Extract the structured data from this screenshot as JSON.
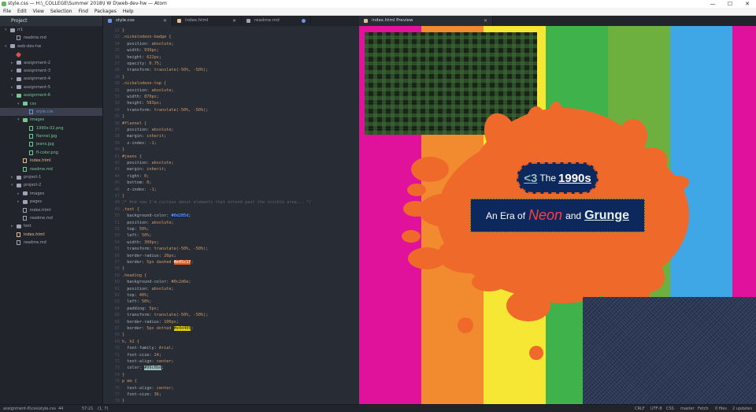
{
  "window": {
    "title": "style.css — H:\\_COLLEGE\\Summer 2018\\I W D\\web-dev-hw — Atom",
    "min": "—",
    "max": "☐",
    "close": "✕"
  },
  "menu": [
    "File",
    "Edit",
    "View",
    "Selection",
    "Find",
    "Packages",
    "Help"
  ],
  "tree": {
    "header": "Project",
    "rows": [
      {
        "label": "rr1",
        "depth": 0,
        "kind": "folder",
        "open": true
      },
      {
        "label": "readme.md",
        "depth": 1,
        "kind": "file"
      },
      {
        "label": "web-dev-hw",
        "depth": 0,
        "kind": "folder",
        "open": true
      },
      {
        "label": "",
        "depth": 1,
        "kind": "git",
        "color": "red"
      },
      {
        "label": "assignment-2",
        "depth": 1,
        "kind": "folder"
      },
      {
        "label": "assignment-3",
        "depth": 1,
        "kind": "folder"
      },
      {
        "label": "assignment-4",
        "depth": 1,
        "kind": "folder"
      },
      {
        "label": "assignment-5",
        "depth": 1,
        "kind": "folder"
      },
      {
        "label": "assignment-6",
        "depth": 1,
        "kind": "folder",
        "open": true,
        "color": "green"
      },
      {
        "label": "css",
        "depth": 2,
        "kind": "folder",
        "open": true,
        "color": "green"
      },
      {
        "label": "style.css",
        "depth": 3,
        "kind": "file",
        "color": "blue",
        "selected": true
      },
      {
        "label": "images",
        "depth": 2,
        "kind": "folder",
        "open": true,
        "color": "green"
      },
      {
        "label": "1990s-02.png",
        "depth": 3,
        "kind": "file",
        "color": "green"
      },
      {
        "label": "flannel.jpg",
        "depth": 3,
        "kind": "file",
        "color": "green"
      },
      {
        "label": "jeans.jpg",
        "depth": 3,
        "kind": "file",
        "color": "green"
      },
      {
        "label": "fl-color.png",
        "depth": 3,
        "kind": "file",
        "color": "green"
      },
      {
        "label": "index.html",
        "depth": 2,
        "kind": "file",
        "color": "orange"
      },
      {
        "label": "readme.md",
        "depth": 2,
        "kind": "file",
        "color": "green"
      },
      {
        "label": "project-1",
        "depth": 1,
        "kind": "folder"
      },
      {
        "label": "project-2",
        "depth": 1,
        "kind": "folder",
        "open": true
      },
      {
        "label": "images",
        "depth": 2,
        "kind": "folder"
      },
      {
        "label": "pages",
        "depth": 2,
        "kind": "folder"
      },
      {
        "label": "index.html",
        "depth": 2,
        "kind": "file"
      },
      {
        "label": "readme.md",
        "depth": 2,
        "kind": "file"
      },
      {
        "label": "test",
        "depth": 1,
        "kind": "folder"
      },
      {
        "label": "index.html",
        "depth": 1,
        "kind": "file",
        "color": "orange"
      },
      {
        "label": "readme.md",
        "depth": 1,
        "kind": "file"
      }
    ]
  },
  "tabs": [
    {
      "label": "style.css",
      "active": true,
      "icon_color": "#6494ed",
      "close": "✕"
    },
    {
      "label": "index.html",
      "active": false,
      "icon_color": "#e2c08d",
      "close": "✕"
    },
    {
      "label": "readme.md",
      "active": false,
      "icon_color": "#9da5b4",
      "modified": true
    }
  ],
  "preview_tab": {
    "label": "index.html Preview",
    "close": "✕"
  },
  "editor": {
    "first_line": 22,
    "lines": [
      [
        [
          "sel",
          "}"
        ]
      ],
      [
        [
          "sel",
          ".nickelodeon-badge {"
        ]
      ],
      [
        [
          "pr",
          "  position: "
        ],
        [
          "vl",
          "absolute"
        ],
        [
          "pr",
          ";"
        ]
      ],
      [
        [
          "pr",
          "  width: "
        ],
        [
          "vl",
          "939px"
        ],
        [
          "pr",
          ";"
        ]
      ],
      [
        [
          "pr",
          "  height: "
        ],
        [
          "vl",
          "622px"
        ],
        [
          "pr",
          ";"
        ]
      ],
      [
        [
          "pr",
          "  opacity: "
        ],
        [
          "vl",
          "0.75"
        ],
        [
          "pr",
          ";"
        ]
      ],
      [
        [
          "pr",
          "  transform: "
        ],
        [
          "vl",
          "translate(-50%, -50%)"
        ],
        [
          "pr",
          ";"
        ]
      ],
      [
        [
          "sel",
          "}"
        ]
      ],
      [
        [
          "sel",
          ".nickelodeon-top {"
        ]
      ],
      [
        [
          "pr",
          "  position: "
        ],
        [
          "vl",
          "absolute"
        ],
        [
          "pr",
          ";"
        ]
      ],
      [
        [
          "pr",
          "  width: "
        ],
        [
          "vl",
          "870px"
        ],
        [
          "pr",
          ";"
        ]
      ],
      [
        [
          "pr",
          "  height: "
        ],
        [
          "vl",
          "583px"
        ],
        [
          "pr",
          ";"
        ]
      ],
      [
        [
          "pr",
          "  transform: "
        ],
        [
          "vl",
          "translate(-50%, -50%)"
        ],
        [
          "pr",
          ";"
        ]
      ],
      [
        [
          "sel",
          "}"
        ]
      ],
      [
        [
          "sel",
          "#flannel {"
        ]
      ],
      [
        [
          "pr",
          "  position: "
        ],
        [
          "vl",
          "absolute"
        ],
        [
          "pr",
          ";"
        ]
      ],
      [
        [
          "pr",
          "  margin: "
        ],
        [
          "vl",
          "inherit"
        ],
        [
          "pr",
          ";"
        ]
      ],
      [
        [
          "pr",
          "  z-index: "
        ],
        [
          "vl",
          "-1"
        ],
        [
          "pr",
          ";"
        ]
      ],
      [
        [
          "sel",
          "}"
        ]
      ],
      [
        [
          "sel",
          "#jeans {"
        ]
      ],
      [
        [
          "pr",
          "  position: "
        ],
        [
          "vl",
          "absolute"
        ],
        [
          "pr",
          ";"
        ]
      ],
      [
        [
          "pr",
          "  margin: "
        ],
        [
          "vl",
          "inherit"
        ],
        [
          "pr",
          ";"
        ]
      ],
      [
        [
          "pr",
          "  right: "
        ],
        [
          "vl",
          "0"
        ],
        [
          "pr",
          ";"
        ]
      ],
      [
        [
          "pr",
          "  bottom: "
        ],
        [
          "vl",
          "0"
        ],
        [
          "pr",
          ";"
        ]
      ],
      [
        [
          "pr",
          "  z-index: "
        ],
        [
          "vl",
          "-1"
        ],
        [
          "pr",
          ";"
        ]
      ],
      [
        [
          "sel",
          "}"
        ]
      ],
      [
        [
          "cm",
          "/* And now I'm curious about elements that extend past the visible area... */"
        ]
      ],
      [
        [
          "sel",
          ".text {"
        ]
      ],
      [
        [
          "pr",
          "  background-color: "
        ],
        [
          "hx-a",
          "#0d285d"
        ],
        [
          "pr",
          ";"
        ]
      ],
      [
        [
          "pr",
          "  position: "
        ],
        [
          "vl",
          "absolute"
        ],
        [
          "pr",
          ";"
        ]
      ],
      [
        [
          "pr",
          "  top: "
        ],
        [
          "vl",
          "50%"
        ],
        [
          "pr",
          ";"
        ]
      ],
      [
        [
          "pr",
          "  left: "
        ],
        [
          "vl",
          "50%"
        ],
        [
          "pr",
          ";"
        ]
      ],
      [
        [
          "pr",
          "  width: "
        ],
        [
          "vl",
          "300px"
        ],
        [
          "pr",
          ";"
        ]
      ],
      [
        [
          "pr",
          "  transform: "
        ],
        [
          "vl",
          "translate(-50%, -50%)"
        ],
        [
          "pr",
          ";"
        ]
      ],
      [
        [
          "pr",
          "  border-radius: "
        ],
        [
          "vl",
          "20px"
        ],
        [
          "pr",
          ";"
        ]
      ],
      [
        [
          "pr",
          "  border: "
        ],
        [
          "vl",
          "5px dashed "
        ],
        [
          "hx-b",
          "#e45c1f"
        ],
        [
          "pr",
          ";"
        ]
      ],
      [
        [
          "sel",
          "}"
        ]
      ],
      [
        [
          "sel",
          ".heading {"
        ]
      ],
      [
        [
          "pr",
          "  background-color: "
        ],
        [
          "vl",
          "#0c2d6e"
        ],
        [
          "pr",
          ";"
        ]
      ],
      [
        [
          "pr",
          "  position: "
        ],
        [
          "vl",
          "absolute"
        ],
        [
          "pr",
          ";"
        ]
      ],
      [
        [
          "pr",
          "  top: "
        ],
        [
          "vl",
          "40%"
        ],
        [
          "pr",
          ";"
        ]
      ],
      [
        [
          "pr",
          "  left: "
        ],
        [
          "vl",
          "50%"
        ],
        [
          "pr",
          ";"
        ]
      ],
      [
        [
          "pr",
          "  padding: "
        ],
        [
          "vl",
          "5px"
        ],
        [
          "pr",
          ";"
        ]
      ],
      [
        [
          "pr",
          "  transform: "
        ],
        [
          "vl",
          "translate(-50%, -50%)"
        ],
        [
          "pr",
          ";"
        ]
      ],
      [
        [
          "pr",
          "  border-radius: "
        ],
        [
          "vl",
          "100px"
        ],
        [
          "pr",
          ";"
        ]
      ],
      [
        [
          "pr",
          "  border: "
        ],
        [
          "vl",
          "5px dotted "
        ],
        [
          "hx-c",
          "#e4d400"
        ],
        [
          "pr",
          ";"
        ]
      ],
      [
        [
          "sel",
          "}"
        ]
      ],
      [
        [
          "sel",
          "h, h2 {"
        ]
      ],
      [
        [
          "pr",
          "  font-family: "
        ],
        [
          "vl",
          "Arial"
        ],
        [
          "pr",
          ";"
        ]
      ],
      [
        [
          "pr",
          "  font-size: "
        ],
        [
          "vl",
          "24"
        ],
        [
          "pr",
          ";"
        ]
      ],
      [
        [
          "pr",
          "  text-align: "
        ],
        [
          "vl",
          "center"
        ],
        [
          "pr",
          ";"
        ]
      ],
      [
        [
          "pr",
          "  color: "
        ],
        [
          "hx-d",
          "#99c0bd"
        ],
        [
          "pr",
          ";"
        ]
      ],
      [
        [
          "sel",
          "}"
        ]
      ],
      [
        [
          "sel",
          "p em {"
        ]
      ],
      [
        [
          "pr",
          "  text-align: "
        ],
        [
          "vl",
          "center"
        ],
        [
          "pr",
          ";"
        ]
      ],
      [
        [
          "pr",
          "  font-size: "
        ],
        [
          "vl",
          "36"
        ],
        [
          "pr",
          ";"
        ]
      ],
      [
        [
          "sel",
          "}"
        ]
      ]
    ]
  },
  "preview": {
    "stripes": [
      "#e0119b",
      "#f28a30",
      "#f6e735",
      "#3fb24b",
      "#6eb040",
      "#3fa7e6",
      "#e0119b",
      "#f28a30"
    ],
    "splat_color": "#ef6a2a",
    "badge": {
      "pre": "<3",
      "mid": "The",
      "post": "1990s"
    },
    "heading": {
      "pre": "An Era of",
      "neon": "Neon",
      "and": "and",
      "grunge": "Grunge"
    }
  },
  "status": {
    "left": [
      "assignment-6\\css\\style.css",
      "44",
      "57:21",
      "(1, 7)"
    ],
    "right": [
      "CRLF",
      "UTF-8",
      "CSS",
      "master",
      "Fetch",
      "0 files",
      "2 updates"
    ]
  }
}
